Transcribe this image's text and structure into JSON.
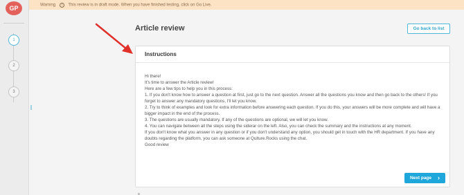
{
  "user": {
    "initials": "GP"
  },
  "steps": [
    "1",
    "2",
    "3"
  ],
  "banner": {
    "warning_label": "Warning",
    "info_icon": "i",
    "message": "This review is in draft mode. When you have finished testing, click on Go Live."
  },
  "header": {
    "title": "Article review",
    "back_label": "Go back to list"
  },
  "card": {
    "title": "Instructions",
    "lines": [
      "Hi there!",
      "It's time to answer the Article review!",
      "Here are a few tips to help you in this process:",
      "1. If you don't know how to answer a question at first, just go to the next question. Answer all the questions you know and then go back to the others! If you forget to answer any mandatory questions, I'll let you know.",
      "2. Try to think of examples and look for extra information before answering each question. If you do this, your answers will be more complete and will have a bigger impact in the end of the process.",
      "3. The questions are usually mandatory. If any of the questions are optional, we will let you know.",
      "4. You can navigate between all the steps using the siderar on the left. Also, you can check the summary and the instructions at any moment.",
      "If you don't know what you answer in any question or if you don't understand any option, you should get in touch with the HR department. If you have any doubts regarding the platform, you can ask someone at Qulture.Rocks using the chat.",
      "Good review"
    ],
    "next_label": "Next page",
    "next_icon": "›"
  },
  "colors": {
    "accent": "#1fa7dc",
    "arrow": "#e0302a",
    "avatar": "#e4615b",
    "banner": "#fce3c4"
  },
  "icons": {
    "next": "chevron-right-icon",
    "annotation": "red-arrow-icon"
  }
}
